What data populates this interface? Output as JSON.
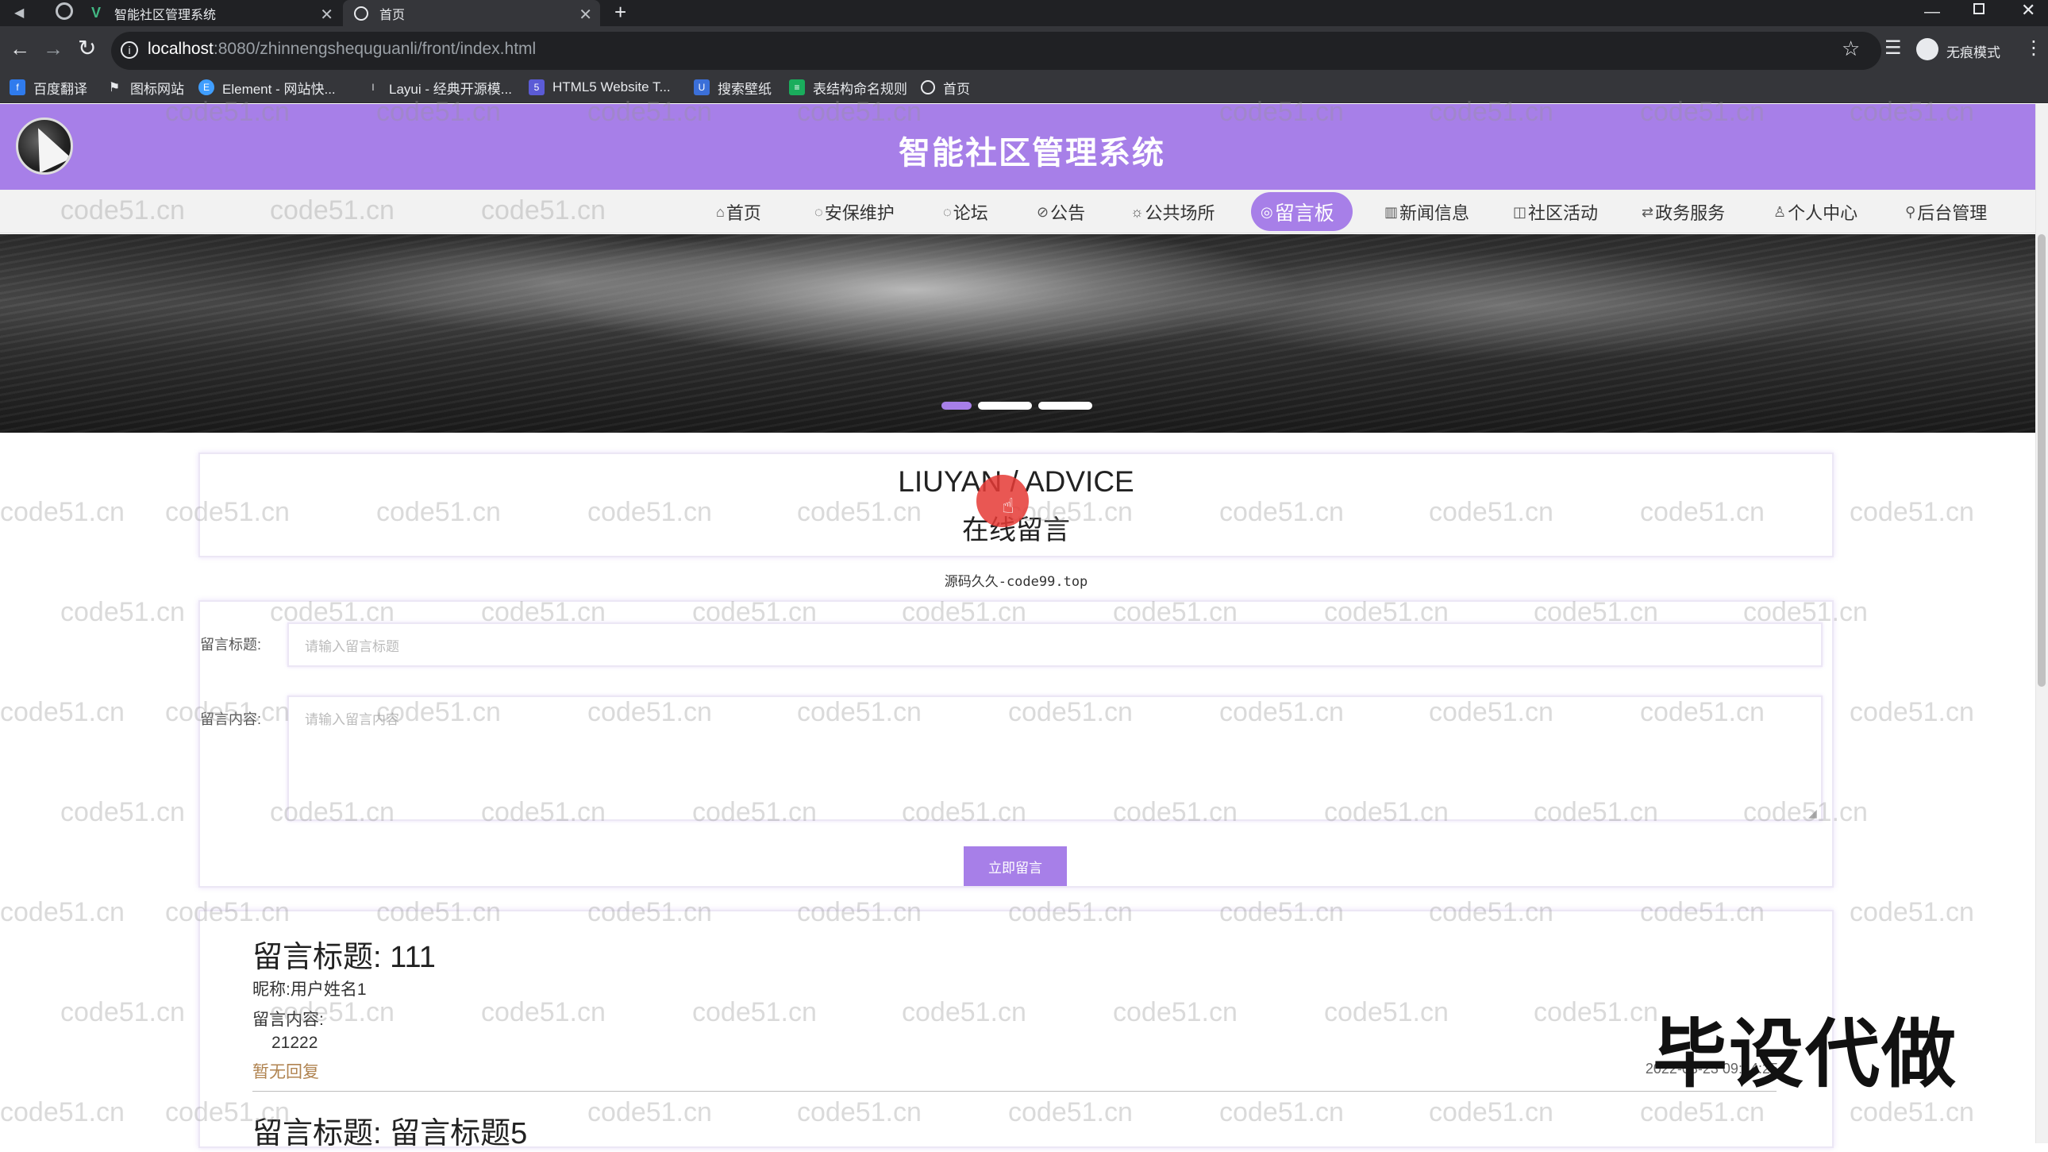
{
  "browser": {
    "tabs": [
      {
        "label": "智能社区管理系统",
        "icon": "vue-logo-icon"
      },
      {
        "label": "首页",
        "icon": "globe-icon"
      }
    ],
    "new_tab": "+",
    "url_host": "localhost",
    "url_path": ":8080/zhinnengshequguanli/front/index.html",
    "profile_label": "无痕模式",
    "bookmarks": [
      "百度翻译",
      "图标网站",
      "Element - 网站快...",
      "Layui - 经典开源模...",
      "HTML5 Website T...",
      "搜索壁纸",
      "表结构命名规则",
      "首页"
    ]
  },
  "site": {
    "title": "智能社区管理系统",
    "accent_color": "#a77fe8"
  },
  "nav": {
    "items": [
      {
        "label": "首页",
        "icon": "home-icon"
      },
      {
        "label": "安保维护",
        "icon": "shield-icon"
      },
      {
        "label": "论坛",
        "icon": "forum-icon"
      },
      {
        "label": "公告",
        "icon": "announcement-icon"
      },
      {
        "label": "公共场所",
        "icon": "place-icon"
      },
      {
        "label": "留言板",
        "icon": "message-icon",
        "active": true
      },
      {
        "label": "新闻信息",
        "icon": "news-icon"
      },
      {
        "label": "社区活动",
        "icon": "activity-icon"
      },
      {
        "label": "政务服务",
        "icon": "service-icon"
      },
      {
        "label": "个人中心",
        "icon": "user-icon"
      },
      {
        "label": "后台管理",
        "icon": "link-icon"
      }
    ]
  },
  "banner": {
    "active_slide": 1,
    "slide_count": 3
  },
  "section": {
    "title_en": "LIUYAN / ADVICE",
    "title_cn": "在线留言",
    "source_note": "源码久久-code99.top"
  },
  "form": {
    "title_label": "留言标题:",
    "title_placeholder": "请输入留言标题",
    "content_label": "留言内容:",
    "content_placeholder": "请输入留言内容",
    "submit_label": "立即留言"
  },
  "messages": [
    {
      "title_prefix": "留言标题:",
      "title": "111",
      "nickname_label": "昵称:",
      "nickname": "用户姓名1",
      "content_label": "留言内容:",
      "content": "21222",
      "reply": "暂无回复",
      "date": "2022-03-23 09:14:25"
    },
    {
      "title_prefix": "留言标题:",
      "title": "留言标题5"
    }
  ],
  "watermark": {
    "text": "code51.cn",
    "corner_text": "毕设代做"
  }
}
